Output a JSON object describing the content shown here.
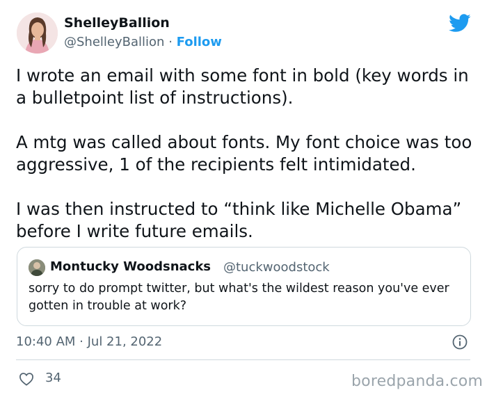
{
  "author": {
    "display_name": "ShelleyBallion",
    "handle": "@ShelleyBallion",
    "separator": "·",
    "follow_label": "Follow"
  },
  "tweet": {
    "paragraphs": [
      "I wrote an email with some font in bold (key words in a bulletpoint list of instructions).",
      "A mtg was called about fonts. My font choice was too aggressive, 1 of the recipients felt intimidated.",
      "I was then instructed to “think like Michelle Obama” before I write future emails."
    ],
    "timestamp": "10:40 AM · Jul 21, 2022",
    "like_count": "34"
  },
  "quoted_tweet": {
    "display_name": "Montucky Woodsnacks",
    "handle": "@tuckwoodstock",
    "text": "sorry to do prompt twitter, but what's the wildest reason you've ever gotten in trouble at work?"
  },
  "watermark": "boredpanda.com",
  "colors": {
    "accent": "#1d9bf0",
    "text": "#0f1419",
    "secondary_text": "#536471",
    "border": "#cfd9de"
  },
  "icons": {
    "brand": "twitter-bird-icon",
    "info": "info-icon",
    "like": "heart-icon"
  }
}
